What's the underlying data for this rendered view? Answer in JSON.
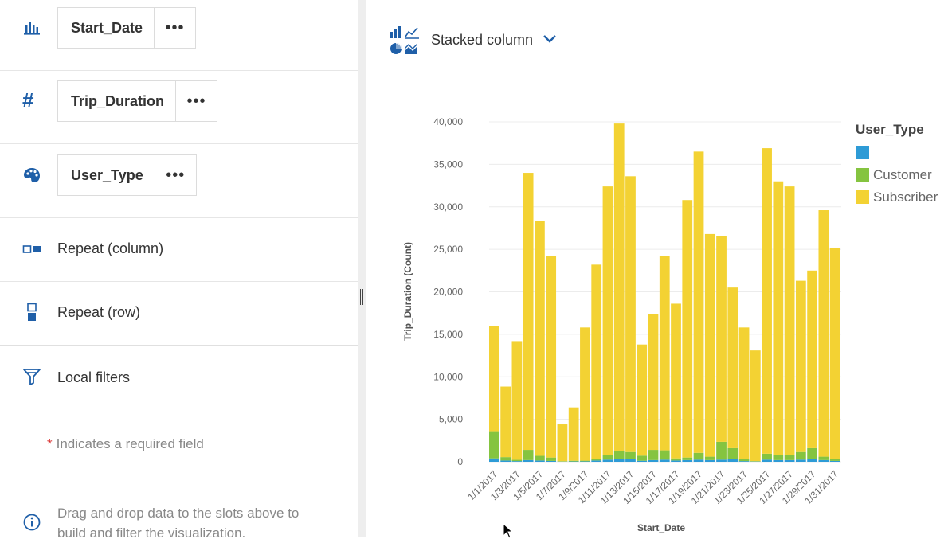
{
  "slots": {
    "x_axis": {
      "icon": "bar-chart-icon",
      "field": "Start_Date",
      "more": "•••"
    },
    "y_axis": {
      "icon": "hash-icon",
      "symbol": "#",
      "field": "Trip_Duration",
      "more": "•••"
    },
    "color": {
      "icon": "palette-icon",
      "field": "User_Type",
      "more": "•••"
    },
    "repeat_column": {
      "icon": "repeat-column-icon",
      "label": "Repeat (column)"
    },
    "repeat_row": {
      "icon": "repeat-row-icon",
      "label": "Repeat (row)"
    },
    "local_filters": {
      "icon": "filter-icon",
      "label": "Local filters"
    }
  },
  "required_note": {
    "star": "*",
    "text": "Indicates a required field"
  },
  "info_note": {
    "icon": "info-icon",
    "line1": "Drag and drop data to the slots above to",
    "line2": "build and filter the visualization."
  },
  "chart_type": {
    "icon": "chart-types-icon",
    "label": "Stacked column",
    "dropdown_icon": "chevron-down-icon"
  },
  "colors": {
    "accent": "#1f5fa8",
    "blank": "#2e9bd6",
    "customer": "#85c440",
    "subscriber": "#f3d233"
  },
  "chart_data": {
    "type": "bar",
    "stacked": true,
    "xlabel": "Start_Date",
    "ylabel": "Trip_Duration (Count)",
    "ylim": [
      0,
      40000
    ],
    "yticks": [
      "0",
      "5,000",
      "10,000",
      "15,000",
      "20,000",
      "25,000",
      "30,000",
      "35,000",
      "40,000"
    ],
    "grid": true,
    "legend": {
      "title": "User_Type",
      "position": "top-right"
    },
    "categories": [
      "1/1/2017",
      "1/2/2017",
      "1/3/2017",
      "1/4/2017",
      "1/5/2017",
      "1/6/2017",
      "1/7/2017",
      "1/8/2017",
      "1/9/2017",
      "1/10/2017",
      "1/11/2017",
      "1/12/2017",
      "1/13/2017",
      "1/14/2017",
      "1/15/2017",
      "1/16/2017",
      "1/17/2017",
      "1/18/2017",
      "1/19/2017",
      "1/20/2017",
      "1/21/2017",
      "1/22/2017",
      "1/23/2017",
      "1/24/2017",
      "1/25/2017",
      "1/26/2017",
      "1/27/2017",
      "1/28/2017",
      "1/29/2017",
      "1/30/2017",
      "1/31/2017"
    ],
    "xticks": [
      "1/1/2017",
      "1/3/2017",
      "1/5/2017",
      "1/7/2017",
      "1/9/2017",
      "1/11/2017",
      "1/13/2017",
      "1/15/2017",
      "1/17/2017",
      "1/19/2017",
      "1/21/2017",
      "1/23/2017",
      "1/25/2017",
      "1/27/2017",
      "1/29/2017",
      "1/31/2017"
    ],
    "series": [
      {
        "name": "",
        "values": [
          400,
          150,
          80,
          200,
          150,
          100,
          20,
          40,
          50,
          150,
          250,
          300,
          350,
          120,
          200,
          250,
          150,
          200,
          250,
          200,
          250,
          300,
          80,
          30,
          250,
          200,
          200,
          250,
          300,
          200,
          100
        ]
      },
      {
        "name": "Customer",
        "values": [
          3200,
          400,
          150,
          1200,
          550,
          400,
          50,
          80,
          80,
          200,
          500,
          1000,
          800,
          600,
          1200,
          1100,
          250,
          300,
          800,
          400,
          2100,
          1300,
          200,
          50,
          700,
          600,
          600,
          900,
          1300,
          400,
          250
        ]
      },
      {
        "name": "Subscriber",
        "values": [
          12400,
          8300,
          13970,
          32600,
          27600,
          23700,
          4330,
          6280,
          15670,
          22850,
          31650,
          38500,
          32450,
          13080,
          15980,
          22850,
          18200,
          30300,
          35450,
          26200,
          24250,
          18900,
          15520,
          13020,
          35950,
          32200,
          31600,
          20150,
          20900,
          29000,
          24850
        ]
      }
    ]
  }
}
